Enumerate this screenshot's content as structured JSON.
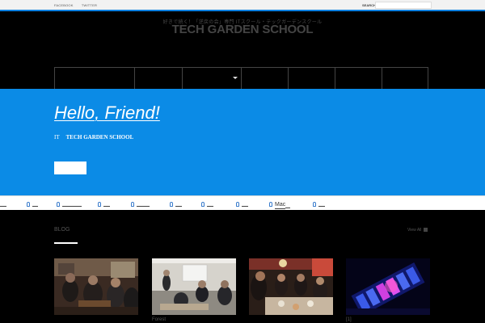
{
  "topbar": {
    "social": [
      "FACEBOOK",
      "TWITTER"
    ],
    "search_label": "SEARCH",
    "search_placeholder": ""
  },
  "logo": {
    "tagline": "好きで続く！「逆戻の会」専門 ITスクール・テックガーデンスクール",
    "title": "TECH GARDEN SCHOOL"
  },
  "nav": {
    "items": [
      {
        "label": "",
        "has_dropdown": false
      },
      {
        "label": "",
        "has_dropdown": false
      },
      {
        "label": "",
        "has_dropdown": true
      },
      {
        "label": "",
        "has_dropdown": false
      },
      {
        "label": "",
        "has_dropdown": false
      },
      {
        "label": "",
        "has_dropdown": false
      },
      {
        "label": "",
        "has_dropdown": false
      }
    ]
  },
  "hero": {
    "title": "Hello, Friend!",
    "prefix": "IT",
    "text": "TECH GARDEN SCHOOL",
    "button_label": ""
  },
  "linkbar": {
    "items": [
      {
        "label": ""
      },
      {
        "label": ""
      },
      {
        "label": ""
      },
      {
        "label": ""
      },
      {
        "label": ""
      },
      {
        "label": ""
      },
      {
        "label": "Mac"
      },
      {
        "label": ""
      }
    ]
  },
  "blog": {
    "title": "BLOG",
    "view_all": "View All",
    "posts": [
      {
        "caption": ""
      },
      {
        "caption": "Forest"
      },
      {
        "caption": ""
      },
      {
        "caption": "[1]"
      }
    ]
  },
  "colors": {
    "accent": "#0b8be6",
    "background": "#000000",
    "topbar": "#f2f2f2"
  }
}
